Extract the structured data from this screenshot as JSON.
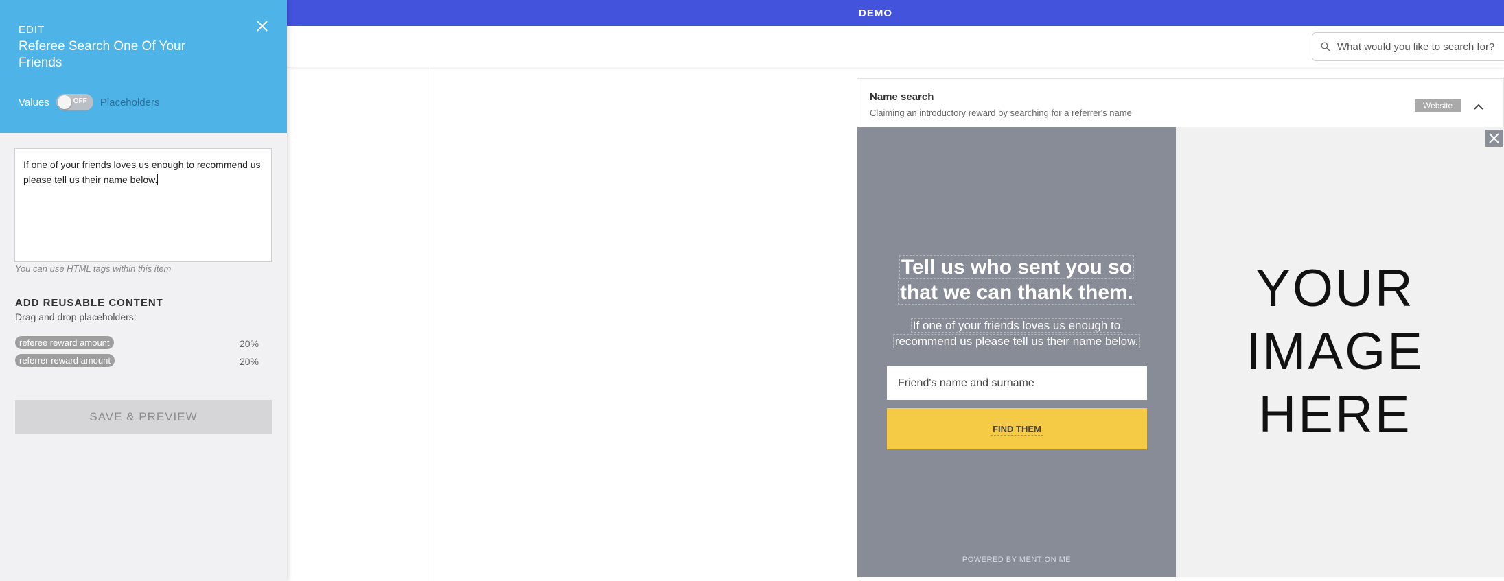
{
  "topbar": {
    "brand": "DEMO"
  },
  "search": {
    "placeholder": "What would you like to search for?"
  },
  "sidebar": {
    "edit_label": "EDIT",
    "title": "Referee Search One Of Your Friends",
    "toggle": {
      "left_label": "Values",
      "state": "OFF",
      "right_label": "Placeholders"
    },
    "editor_text": "If one of your friends loves us enough to recommend us please tell us their name below.",
    "html_hint": "You can use HTML tags within this item",
    "reusable": {
      "title": "ADD REUSABLE CONTENT",
      "subtitle": "Drag and drop placeholders:",
      "items": [
        {
          "label": "referee reward amount",
          "value": "20%"
        },
        {
          "label": "referrer reward amount",
          "value": "20%"
        }
      ]
    },
    "save_label": "SAVE & PREVIEW"
  },
  "card": {
    "title": "Name search",
    "subtitle": "Claiming an introductory reward by searching for a referrer's name",
    "badge": "Website"
  },
  "preview": {
    "headline_line1": "Tell us who sent you so",
    "headline_line2": "that we can thank them.",
    "subtext_line1": "If one of your friends loves us enough to",
    "subtext_line2": "recommend us please tell us their name below.",
    "input_placeholder": "Friend's name and surname",
    "button_label": "FIND THEM",
    "powered_by": "POWERED BY MENTION ME",
    "image_line1": "YOUR",
    "image_line2": "IMAGE",
    "image_line3": "HERE"
  },
  "colors": {
    "topbar": "#4353db",
    "sidebar_header": "#4eb3e6",
    "preview_left": "#878c96",
    "cta": "#f5ca45"
  }
}
